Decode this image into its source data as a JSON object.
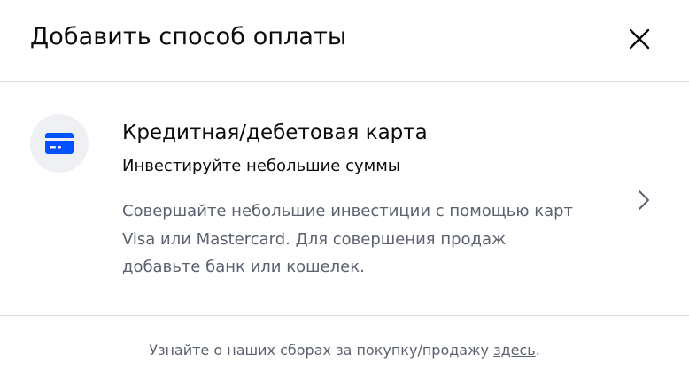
{
  "modal": {
    "title": "Добавить способ оплаты",
    "close_icon": "close-icon"
  },
  "option": {
    "icon": "credit-card-icon",
    "title": "Кредитная/дебетовая карта",
    "subtitle": "Инвестируйте небольшие суммы",
    "description_lines": [
      "Совершайте небольшие инвестиции с помощью карт",
      "Visa или Mastercard. Для совершения продаж",
      "добавьте банк или кошелек."
    ],
    "chevron_icon": "chevron-right-icon"
  },
  "footer": {
    "text": "Узнайте о наших сборах за покупку/продажу ",
    "link": "здесь",
    "suffix": "."
  },
  "colors": {
    "accent": "#0052ff",
    "icon_bg": "#eef0f3",
    "secondary_text": "#5b616e",
    "divider": "#dcdde0"
  }
}
